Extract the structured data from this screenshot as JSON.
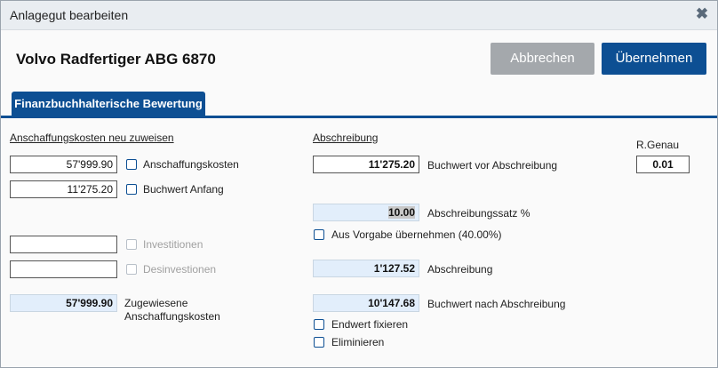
{
  "window": {
    "title": "Anlagegut bearbeiten"
  },
  "header": {
    "asset_name": "Volvo Radfertiger ABG 6870"
  },
  "buttons": {
    "cancel": "Abbrechen",
    "apply": "Übernehmen"
  },
  "tabs": [
    {
      "label": "Finanzbuchhalterische Bewertung",
      "active": true
    }
  ],
  "left": {
    "section_title": "Anschaffungskosten neu zuweisen",
    "anschaffungskosten": {
      "value": "57'999.90",
      "label": "Anschaffungskosten",
      "checked": false
    },
    "buchwert_anfang": {
      "value": "11'275.20",
      "label": "Buchwert Anfang",
      "checked": false
    },
    "investitionen": {
      "value": "",
      "label": "Investitionen",
      "disabled": true
    },
    "desinvestitionen": {
      "value": "",
      "label": "Desinvestionen",
      "disabled": true
    },
    "zugewiesene": {
      "value": "57'999.90",
      "label_line1": "Zugewiesene",
      "label_line2": "Anschaffungskosten"
    }
  },
  "right": {
    "section_title": "Abschreibung",
    "buchwert_vor": {
      "value": "11'275.20",
      "label": "Buchwert vor Abschreibung"
    },
    "rgenau": {
      "label": "R.Genau",
      "value": "0.01"
    },
    "satz": {
      "value": "10.00",
      "label": "Abschreibungssatz %"
    },
    "aus_vorgabe": {
      "label": "Aus Vorgabe übernehmen (40.00%)",
      "checked": false
    },
    "abschreibung": {
      "value": "1'127.52",
      "label": "Abschreibung"
    },
    "buchwert_nach": {
      "value": "10'147.68",
      "label": "Buchwert nach Abschreibung"
    },
    "endwert_fixieren": {
      "label": "Endwert fixieren",
      "checked": false
    },
    "eliminieren": {
      "label": "Eliminieren",
      "checked": false
    }
  },
  "colors": {
    "primary": "#0d4f93",
    "cancel_button": "#a4a8ac",
    "readonly_field": "#e2eefb",
    "checkbox_border": "#0d4f93"
  }
}
